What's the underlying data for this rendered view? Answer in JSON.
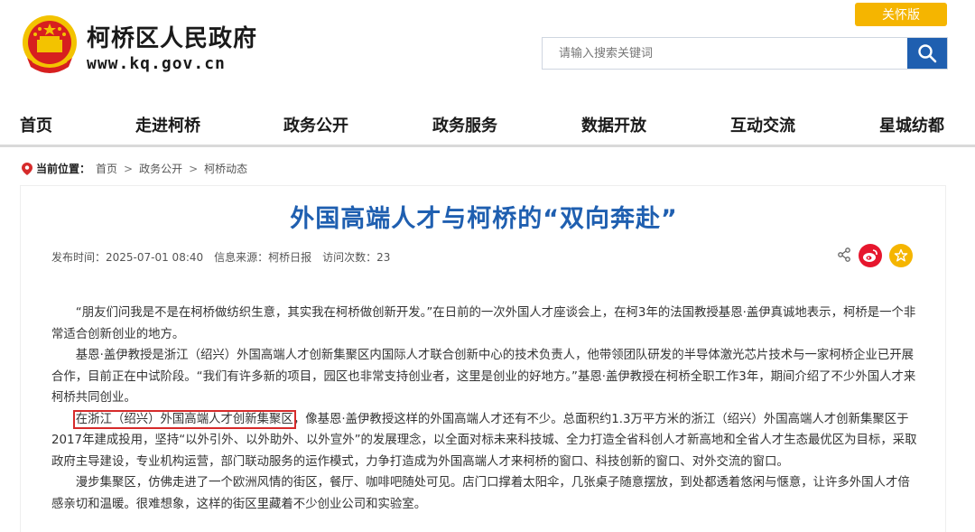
{
  "header": {
    "site_title": "柯桥区人民政府",
    "site_url": "www.kq.gov.cn",
    "care_mode_label": "关怀版",
    "search_placeholder": "请输入搜索关键词"
  },
  "nav": {
    "items": [
      "首页",
      "走进柯桥",
      "政务公开",
      "政务服务",
      "数据开放",
      "互动交流",
      "星城纺都"
    ]
  },
  "breadcrumb": {
    "label": "当前位置：",
    "items": [
      "首页",
      "政务公开",
      "柯桥动态"
    ],
    "separator": ">"
  },
  "article": {
    "title": "外国高端人才与柯桥的“双向奔赴”",
    "publish_label": "发布时间：2025-07-01 08:40",
    "source_label": "信息来源：柯桥日报",
    "visits_label": "访问次数：23",
    "paragraphs": [
      "“朋友们问我是不是在柯桥做纺织生意，其实我在柯桥做创新开发。”在日前的一次外国人才座谈会上，在柯3年的法国教授基恩·盖伊真诚地表示，柯桥是一个非常适合创新创业的地方。",
      "基恩·盖伊教授是浙江（绍兴）外国高端人才创新集聚区内国际人才联合创新中心的技术负责人，他带领团队研发的半导体激光芯片技术与一家柯桥企业已开展合作，目前正在中试阶段。“我们有许多新的项目，园区也非常支持创业者，这里是创业的好地方。”基恩·盖伊教授在柯桥全职工作3年，期间介绍了不少外国人才来柯桥共同创业。"
    ],
    "highlight_text": "在浙江（绍兴）外国高端人才创新集聚区",
    "paragraph3_rest": "，像基恩·盖伊教授这样的外国高端人才还有不少。总面积约1.3万平方米的浙江（绍兴）外国高端人才创新集聚区于2017年建成投用，坚持“以外引外、以外助外、以外宣外”的发展理念，以全面对标未来科技城、全力打造全省科创人才新高地和全省人才生态最优区为目标，采取政府主导建设，专业机构运营，部门联动服务的运作模式，力争打造成为外国高端人才来柯桥的窗口、科技创新的窗口、对外交流的窗口。",
    "paragraph4": "漫步集聚区，仿佛走进了一个欧洲风情的街区，餐厅、咖啡吧随处可见。店门口撑着太阳伞，几张桌子随意摆放，到处都透着悠闲与惬意，让许多外国人才倍感亲切和温暖。很难想象，这样的街区里藏着不少创业公司和实验室。"
  },
  "colors": {
    "brand_blue": "#1f5fb0",
    "care_gold": "#f5b500",
    "highlight_red": "#d62b2b",
    "weibo_red": "#e6162d"
  },
  "icons": {
    "emblem": "national-emblem-icon",
    "search": "search-icon",
    "location": "location-pin-icon",
    "share": "share-icon",
    "weibo": "weibo-icon",
    "favorite": "star-icon"
  }
}
